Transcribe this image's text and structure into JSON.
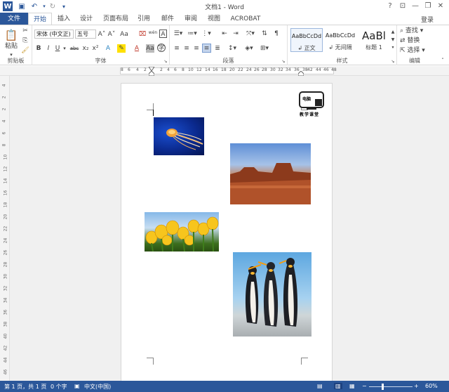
{
  "titlebar": {
    "title": "文档1 - Word",
    "help": "?",
    "min": "—",
    "restore": "❐",
    "close": "✕",
    "login": "登录"
  },
  "quickaccess": {
    "save": "▣",
    "undo": "↶",
    "redo": "↻",
    "custom": "▾"
  },
  "tabs": [
    "文件",
    "开始",
    "插入",
    "设计",
    "页面布局",
    "引用",
    "邮件",
    "审阅",
    "视图",
    "ACROBAT"
  ],
  "ribbon": {
    "clipboard": {
      "label": "剪贴板",
      "paste": "粘贴"
    },
    "font": {
      "label": "字体",
      "name": "宋体 (中文正)",
      "size": "五号",
      "buttons": [
        "A˄",
        "A˅",
        "Aa",
        "⌧",
        "wén",
        "A",
        "B",
        "I",
        "U",
        "abc",
        "x₂",
        "x²",
        "A",
        "✎",
        "A",
        "Aa",
        "A",
        "字"
      ]
    },
    "paragraph": {
      "label": "段落"
    },
    "styles": {
      "label": "样式",
      "items": [
        {
          "preview": "AaBbCcDd",
          "name": "↲ 正文"
        },
        {
          "preview": "AaBbCcDd",
          "name": "↲ 无间隔"
        },
        {
          "preview": "AaBl",
          "name": "标题 1"
        }
      ]
    },
    "editing": {
      "label": "编辑",
      "find": "查找",
      "replace": "替换",
      "select": "选择"
    }
  },
  "ruler": {
    "numbers": [
      "8",
      "6",
      "4",
      "2",
      "2",
      "4",
      "6",
      "8",
      "10",
      "12",
      "14",
      "16",
      "18",
      "20",
      "22",
      "24",
      "26",
      "28",
      "30",
      "32",
      "34",
      "36",
      "38",
      "42",
      "44",
      "46",
      "48"
    ]
  },
  "vruler": {
    "numbers": [
      "4",
      "2",
      "2",
      "4",
      "6",
      "8",
      "10",
      "12",
      "14",
      "16",
      "18",
      "20",
      "22",
      "24",
      "26",
      "28",
      "30",
      "32",
      "34",
      "36",
      "38",
      "40",
      "42",
      "44",
      "46"
    ]
  },
  "stamp": {
    "line1": "电脑",
    "line2": "教学课堂"
  },
  "statusbar": {
    "page": "第 1 页，共 1 页",
    "words": "0 个字",
    "lang": "中文(中国)",
    "zoom": "60%"
  },
  "colors": {
    "accent": "#2b579a"
  }
}
